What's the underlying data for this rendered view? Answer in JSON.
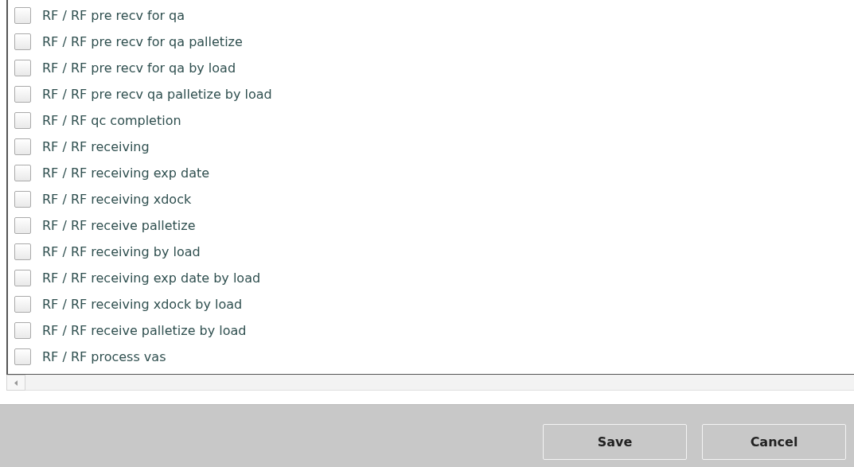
{
  "items": [
    {
      "label": "RF / RF pre recv for qa",
      "checked": false
    },
    {
      "label": "RF / RF pre recv for qa palletize",
      "checked": false
    },
    {
      "label": "RF / RF pre recv for qa by load",
      "checked": false
    },
    {
      "label": "RF / RF pre recv qa palletize by load",
      "checked": false
    },
    {
      "label": "RF / RF qc completion",
      "checked": false
    },
    {
      "label": "RF / RF receiving",
      "checked": false
    },
    {
      "label": "RF / RF receiving exp date",
      "checked": false
    },
    {
      "label": "RF / RF receiving xdock",
      "checked": false
    },
    {
      "label": "RF / RF receive palletize",
      "checked": false
    },
    {
      "label": "RF / RF receiving by load",
      "checked": false
    },
    {
      "label": "RF / RF receiving exp date by load",
      "checked": false
    },
    {
      "label": "RF / RF receiving xdock by load",
      "checked": false
    },
    {
      "label": "RF / RF receive palletize by load",
      "checked": false
    },
    {
      "label": "RF / RF process vas",
      "checked": false
    }
  ],
  "buttons": [
    {
      "label": "Save"
    },
    {
      "label": "Cancel"
    }
  ]
}
